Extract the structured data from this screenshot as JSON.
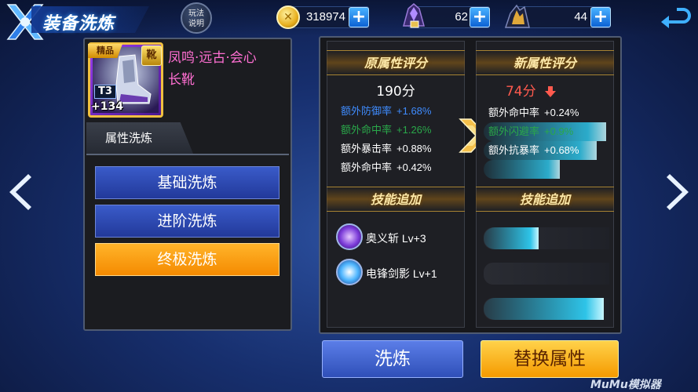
{
  "header": {
    "title": "装备洗炼",
    "help_label_line1": "玩法",
    "help_label_line2": "说明"
  },
  "resources": {
    "coins": "318974",
    "gem_a": "62",
    "gem_b": "44"
  },
  "item": {
    "quality": "精品",
    "tier": "T3",
    "plus_level": "+134",
    "slot_glyph": "靴",
    "name_line1": "凤鸣·远古·会心",
    "name_line2": "长靴"
  },
  "left": {
    "section_tab": "属性洗炼",
    "modes": [
      {
        "label": "基础洗炼"
      },
      {
        "label": "进阶洗炼"
      },
      {
        "label": "终极洗炼"
      }
    ],
    "active_mode_index": 2
  },
  "original": {
    "header": "原属性评分",
    "score": "190分",
    "attributes": [
      {
        "name": "额外防御率",
        "value": "+1.68%",
        "name_color": "#3f8cff",
        "value_color": "#3f8cff"
      },
      {
        "name": "额外命中率",
        "value": "+1.26%",
        "name_color": "#2aa84a",
        "value_color": "#2aa84a"
      },
      {
        "name": "额外暴击率",
        "value": "+0.88%",
        "name_color": "#ffffff",
        "value_color": "#ffffff"
      },
      {
        "name": "额外命中率",
        "value": "+0.42%",
        "name_color": "#ffffff",
        "value_color": "#ffffff"
      }
    ],
    "skill_header": "技能追加",
    "skills": [
      {
        "name": "奥义斩 Lv+3",
        "icon": "purple-swirl-icon"
      },
      {
        "name": "电锋剑影 Lv+1",
        "icon": "blue-flare-icon"
      }
    ]
  },
  "new": {
    "header": "新属性评分",
    "score": "74分",
    "score_color": "#ff5a4e",
    "trend": "down",
    "attributes": [
      {
        "name": "额外命中率",
        "value": "+0.24%",
        "name_color": "#ffffff",
        "value_color": "#ffffff",
        "fill": 0.0
      },
      {
        "name": "额外闪避率",
        "value": "+0.9%",
        "name_color": "#2aa84a",
        "value_color": "#2aa84a",
        "fill": 1.0
      },
      {
        "name": "额外抗暴率",
        "value": "+0.68%",
        "name_color": "#ffffff",
        "value_color": "#ffffff",
        "fill": 0.92
      },
      {
        "name": "",
        "value": "",
        "name_color": "#ffffff",
        "value_color": "#ffffff",
        "fill": 0.62
      }
    ],
    "skill_header": "技能追加",
    "skill_bars": [
      0.45,
      0.0,
      0.98
    ]
  },
  "actions": {
    "wash": "洗炼",
    "replace": "替换属性"
  },
  "watermark": "MuMu模拟器"
}
